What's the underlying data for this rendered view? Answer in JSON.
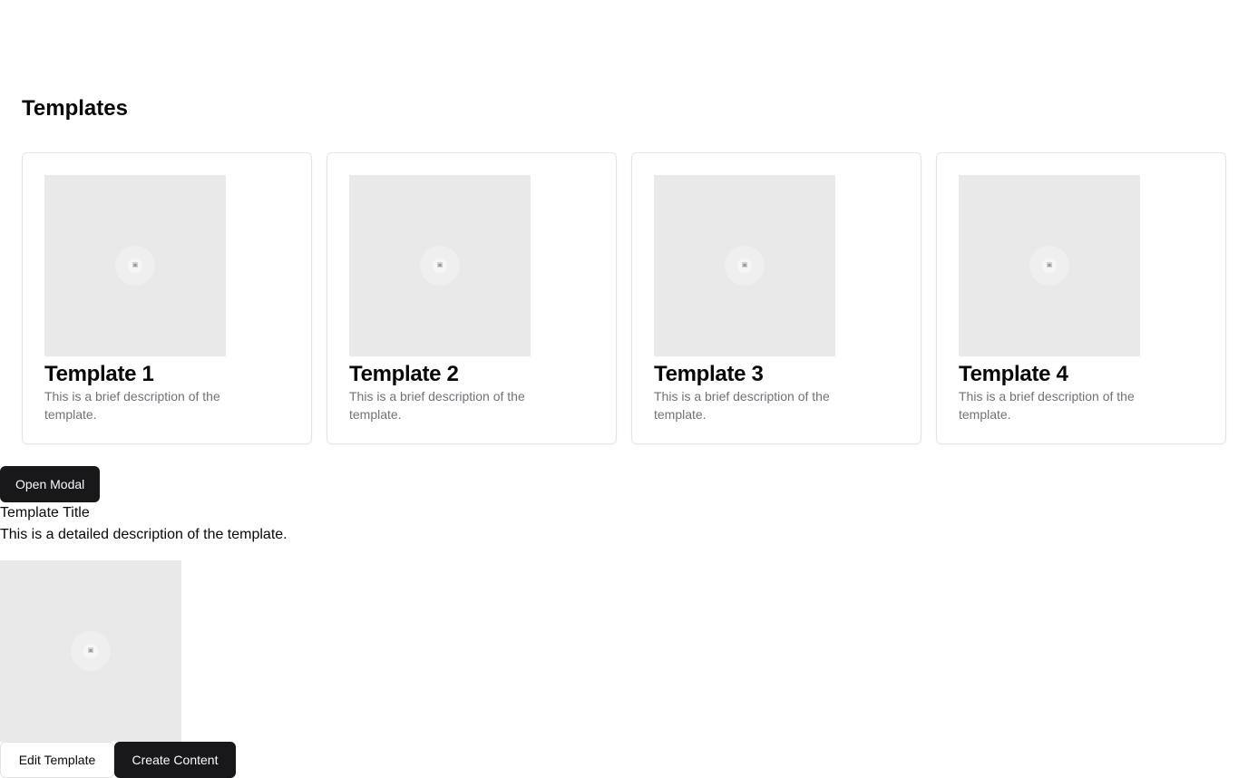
{
  "page": {
    "title": "Templates"
  },
  "templates": [
    {
      "title": "Template 1",
      "description": "This is a brief description of the template."
    },
    {
      "title": "Template 2",
      "description": "This is a brief description of the template."
    },
    {
      "title": "Template 3",
      "description": "This is a brief description of the template."
    },
    {
      "title": "Template 4",
      "description": "This is a brief description of the template."
    }
  ],
  "modal": {
    "open_label": "Open Modal",
    "title": "Template Title",
    "description": "This is a detailed description of the template.",
    "edit_label": "Edit Template",
    "create_label": "Create Content"
  },
  "colors": {
    "primary": "#18181b",
    "muted_text": "#71717a",
    "placeholder": "#e9e9e9"
  }
}
